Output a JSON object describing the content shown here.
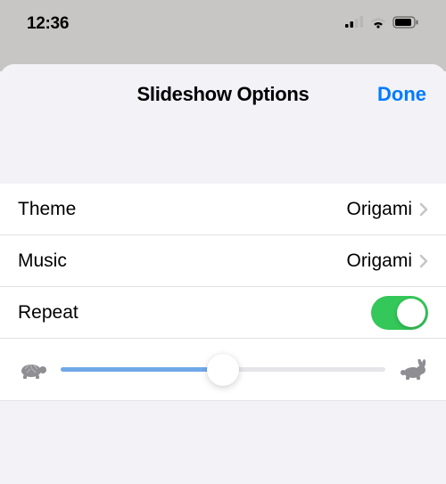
{
  "status": {
    "time": "12:36"
  },
  "sheet": {
    "title": "Slideshow Options",
    "done_label": "Done"
  },
  "rows": {
    "theme": {
      "label": "Theme",
      "value": "Origami"
    },
    "music": {
      "label": "Music",
      "value": "Origami"
    },
    "repeat": {
      "label": "Repeat",
      "on": true
    }
  },
  "slider": {
    "min_icon": "turtle",
    "max_icon": "rabbit",
    "value_percent": 50
  },
  "colors": {
    "accent": "#007aff",
    "toggle_on": "#34c759",
    "slider_fill": "#6fa8e8"
  }
}
